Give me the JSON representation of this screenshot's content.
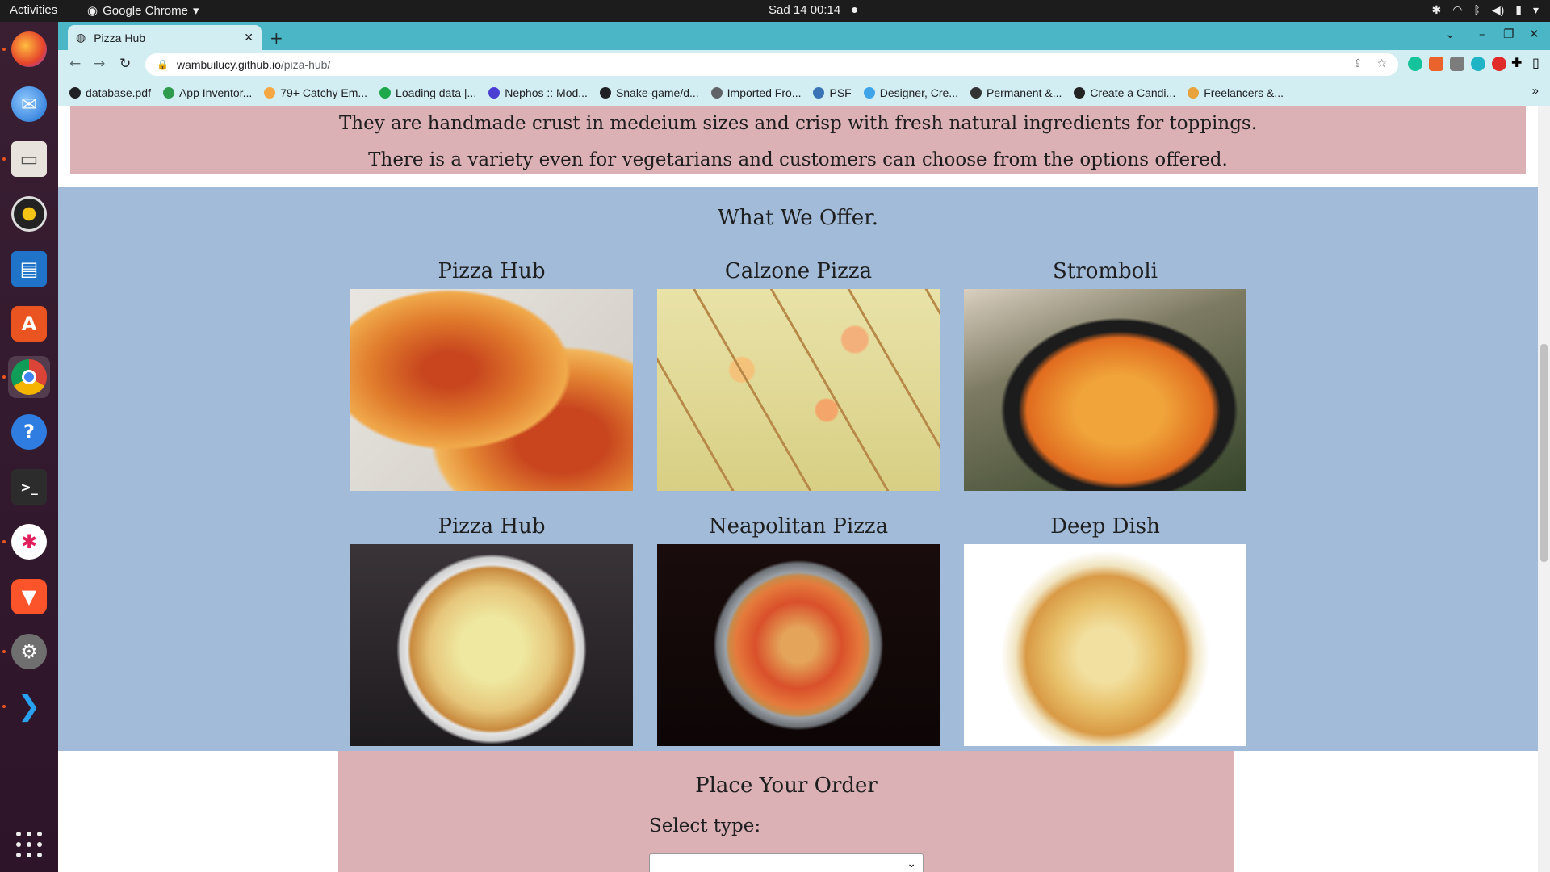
{
  "topbar": {
    "activities": "Activities",
    "app_name": "Google Chrome",
    "clock": "Sad 14  00:14"
  },
  "dock": {
    "items": [
      "firefox-icon",
      "thunderbird-icon",
      "files-icon",
      "rhythmbox-icon",
      "writer-icon",
      "software-icon",
      "chrome-icon",
      "help-icon",
      "terminal-icon",
      "slack-icon",
      "brave-icon",
      "settings-icon",
      "vscode-icon"
    ]
  },
  "browser": {
    "tab_title": "Pizza Hub",
    "url_host": "wambuilucy.github.io",
    "url_path": "/piza-hub/",
    "bookmarks": [
      {
        "label": "database.pdf",
        "color": "#202124"
      },
      {
        "label": "App Inventor...",
        "color": "#2e9a4e"
      },
      {
        "label": "79+ Catchy Em...",
        "color": "#f4a742"
      },
      {
        "label": "Loading data |...",
        "color": "#1ea84b"
      },
      {
        "label": "Nephos :: Mod...",
        "color": "#4b3fd3"
      },
      {
        "label": "Snake-game/d...",
        "color": "#202124"
      },
      {
        "label": "Imported Fro...",
        "color": "#5f6368"
      },
      {
        "label": "PSF",
        "color": "#3b74b6"
      },
      {
        "label": "Designer, Cre...",
        "color": "#3fa3e8"
      },
      {
        "label": "Permanent &...",
        "color": "#333333"
      },
      {
        "label": "Create a Candi...",
        "color": "#222222"
      },
      {
        "label": "Freelancers &...",
        "color": "#e8a33c"
      }
    ]
  },
  "page": {
    "intro_line1": "They are handmade crust in medeium sizes and crisp with fresh natural ingredients for toppings.",
    "intro_line2": "There is a variety even for vegetarians and customers can choose from the options offered.",
    "offer_title": "What We Offer.",
    "items": [
      {
        "name": "Pizza Hub"
      },
      {
        "name": "Calzone Pizza"
      },
      {
        "name": "Stromboli"
      },
      {
        "name": "Pizza Hub"
      },
      {
        "name": "Neapolitan Pizza"
      },
      {
        "name": "Deep Dish"
      }
    ],
    "order_title": "Place Your Order",
    "select_label": "Select type:"
  },
  "colors": {
    "intro_bg": "#dbb1b6",
    "offer_bg": "#a1bbd9",
    "chrome_frame": "#4ab6c6",
    "dock_bg": "#3a1f33"
  }
}
